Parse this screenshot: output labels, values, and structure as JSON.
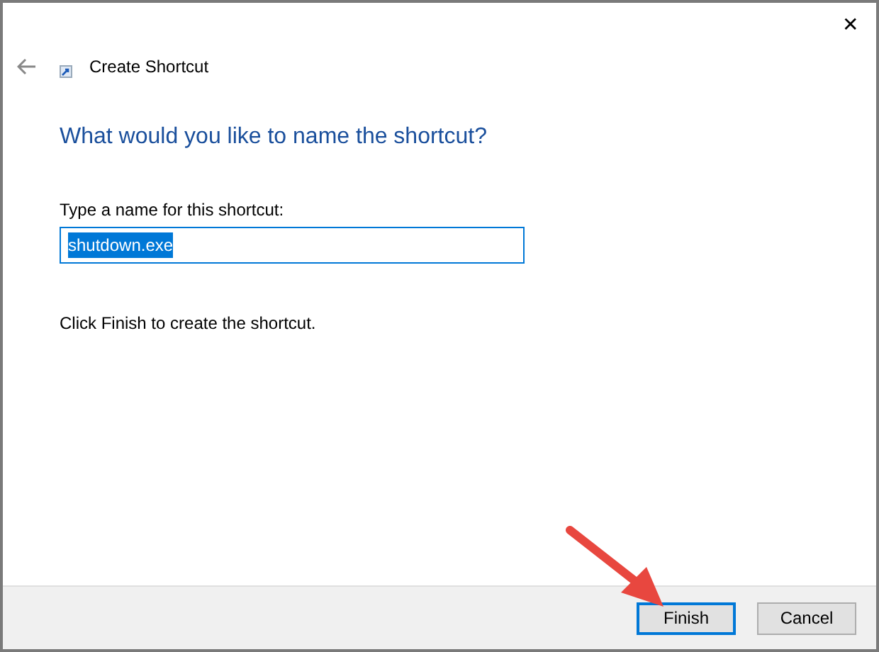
{
  "window": {
    "close": "✕"
  },
  "header": {
    "title": "Create Shortcut"
  },
  "heading": "What would you like to name the shortcut?",
  "name_field": {
    "label": "Type a name for this shortcut:",
    "value": "shutdown.exe",
    "selected": true
  },
  "instruction": "Click Finish to create the shortcut.",
  "buttons": [
    {
      "label": "Finish",
      "selected": true
    },
    {
      "label": "Cancel",
      "selected": false
    }
  ]
}
